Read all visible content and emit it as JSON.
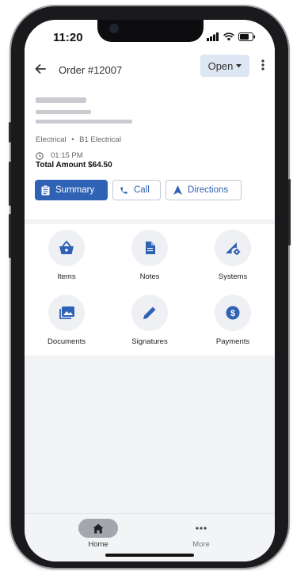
{
  "status_bar": {
    "time": "11:20"
  },
  "header": {
    "title": "Order #12007",
    "status_value": "Open"
  },
  "order": {
    "category": "Electrical",
    "separator": "•",
    "subcategory": "B1 Electrical",
    "time": "01:15 PM",
    "total": "Total Amount $64.50"
  },
  "actions": {
    "summary": "Summary",
    "call": "Call",
    "directions": "Directions"
  },
  "tiles": {
    "items": "Items",
    "notes": "Notes",
    "systems": "Systems",
    "documents": "Documents",
    "signatures": "Signatures",
    "payments": "Payments"
  },
  "bottom_nav": {
    "home": "Home",
    "more": "More"
  },
  "colors": {
    "accent": "#2f62b5",
    "status_chip": "#dde6f3",
    "background": "#f2f3f5"
  }
}
